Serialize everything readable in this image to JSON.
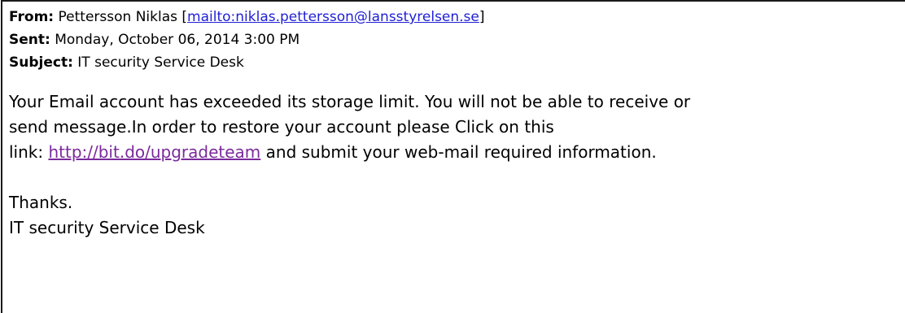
{
  "headers": {
    "from_label": "From:",
    "from_name": "Pettersson Niklas",
    "from_bracket_open": "[",
    "from_mailto": "mailto:niklas.pettersson@lansstyrelsen.se",
    "from_bracket_close": "]",
    "sent_label": "Sent:",
    "sent_value": "Monday, October 06, 2014 3:00 PM",
    "subject_label": "Subject:",
    "subject_value": "IT security Service Desk"
  },
  "body": {
    "line1": "Your Email account has exceeded its storage limit. You will not be able to receive or",
    "line2": "send message.In order to restore your account please Click on this",
    "line3_prefix": "link:",
    "link_text": "http://bit.do/upgradeteam",
    "line3_suffix": "and submit your web-mail required information.",
    "closing": "Thanks.",
    "signature": "IT security Service Desk"
  },
  "colors": {
    "mailto_link": "#1f1fd6",
    "visited_link": "#7b2a9c",
    "border": "#1a1a1a"
  }
}
